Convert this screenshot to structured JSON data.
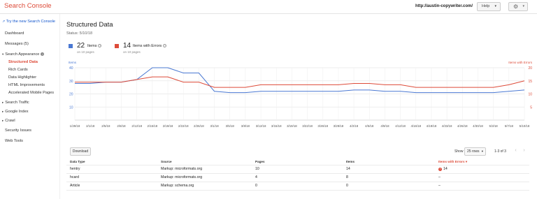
{
  "header": {
    "brand": "Search Console",
    "site_url": "http://austin-copywriter.com/",
    "help_label": "Help",
    "caret": "▾",
    "gear_icon": "⚙"
  },
  "sidebar": {
    "new_console_link": "Try the new Search Console",
    "dashboard": "Dashboard",
    "messages": "Messages (5)",
    "search_appearance": "Search Appearance",
    "info_glyph": "i",
    "items": [
      "Structured Data",
      "Rich Cards",
      "Data Highlighter",
      "HTML Improvements",
      "Accelerated Mobile Pages"
    ],
    "search_traffic": "Search Traffic",
    "google_index": "Google Index",
    "crawl": "Crawl",
    "security_issues": "Security Issues",
    "web_tools": "Web Tools",
    "tri_open": "▾",
    "tri_closed": "▸"
  },
  "main": {
    "title": "Structured Data",
    "status": "Status: 5/10/18",
    "items_metric": {
      "value": "22",
      "label": "Items",
      "sub": "on 10 pages",
      "color": "#4a78d2"
    },
    "errors_metric": {
      "value": "14",
      "label": "Items with Errors",
      "sub": "on 10 pages",
      "color": "#dd4b39"
    },
    "help_glyph": "?"
  },
  "chart_data": {
    "type": "line",
    "left_axis_title": "Items",
    "right_axis_title": "Items with Errors",
    "left_ticks": [
      40,
      30,
      20,
      10
    ],
    "right_ticks": [
      20,
      15,
      10,
      5
    ],
    "ylim_left": [
      0,
      40
    ],
    "ylim_right": [
      0,
      20
    ],
    "x": [
      "1/29/18",
      "2/1/18",
      "2/5/18",
      "2/8/18",
      "2/12/18",
      "2/15/18",
      "2/19/18",
      "2/22/18",
      "2/26/18",
      "3/1/18",
      "3/5/18",
      "3/8/18",
      "3/12/18",
      "3/15/18",
      "3/19/18",
      "3/22/18",
      "3/26/18",
      "3/29/18",
      "4/2/18",
      "4/5/18",
      "4/9/18",
      "4/12/18",
      "4/16/18",
      "4/19/18",
      "4/23/18",
      "4/26/18",
      "4/30/18",
      "5/3/18",
      "5/7/18",
      "5/10/18"
    ],
    "series": [
      {
        "name": "Items",
        "axis": "left",
        "color": "#4a78d2",
        "values": [
          28,
          28,
          29,
          29,
          31,
          40,
          40,
          36,
          36,
          22,
          21,
          21,
          22,
          22,
          22,
          22,
          22,
          22,
          23,
          23,
          22,
          22,
          21,
          21,
          21,
          21,
          21,
          21,
          22,
          23
        ]
      },
      {
        "name": "Items with Errors",
        "axis": "right",
        "color": "#dd4b39",
        "values": [
          14.5,
          14.5,
          14.5,
          14.5,
          15.5,
          16.5,
          16.5,
          14.5,
          14.5,
          12.5,
          12.5,
          12.5,
          13.5,
          13.5,
          13.5,
          13.5,
          13.5,
          13.5,
          14,
          14,
          13.5,
          13.5,
          12.5,
          12.5,
          12.5,
          12.5,
          12.5,
          12.5,
          13.5,
          15
        ]
      }
    ],
    "grid": true
  },
  "controls": {
    "download_label": "Download",
    "show_label": "Show",
    "rows_value": "25 rows",
    "range_text": "1-3 of 3",
    "first": "|‹",
    "prev": "‹",
    "next": "›",
    "last": "›|"
  },
  "table": {
    "headers": [
      "Data Type",
      "Source",
      "Pages",
      "Items",
      "Items with Errors"
    ],
    "sort_caret": "▾",
    "error_glyph": "!",
    "rows": [
      {
        "type": "hentry",
        "source": "Markup: microformats.org",
        "pages": "10",
        "items": "14",
        "errors": "14",
        "has_error": true
      },
      {
        "type": "hcard",
        "source": "Markup: microformats.org",
        "pages": "4",
        "items": "8",
        "errors": "–",
        "has_error": false
      },
      {
        "type": "Article",
        "source": "Markup: schema.org",
        "pages": "0",
        "items": "0",
        "errors": "–",
        "has_error": false
      }
    ]
  }
}
